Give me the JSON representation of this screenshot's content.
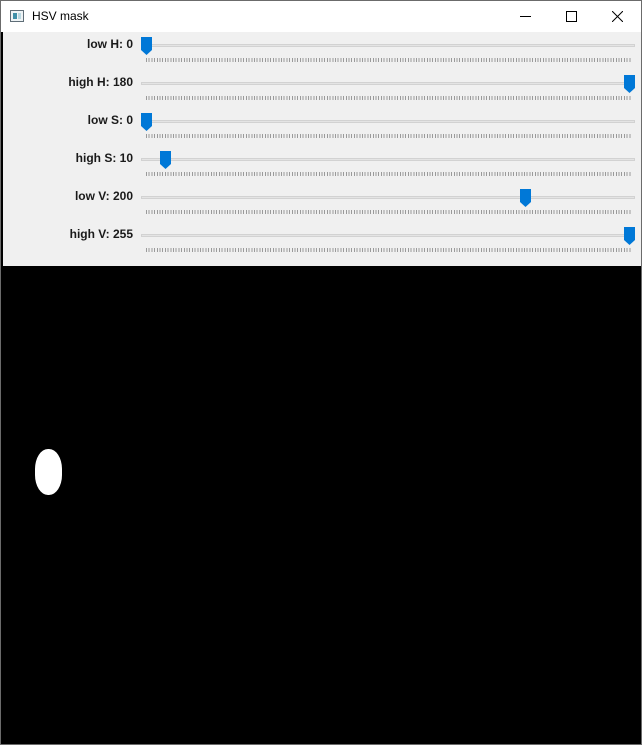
{
  "window": {
    "title": "HSV mask",
    "icon": "app-window-icon",
    "controls": [
      "minimize-icon",
      "maximize-icon",
      "close-icon"
    ]
  },
  "trackbars": [
    {
      "label": "low H: 0",
      "value": 0,
      "max": 180
    },
    {
      "label": "high H: 180",
      "value": 180,
      "max": 180
    },
    {
      "label": "low S: 0",
      "value": 0,
      "max": 255
    },
    {
      "label": "high S: 10",
      "value": 10,
      "max": 255
    },
    {
      "label": "low V: 200",
      "value": 200,
      "max": 255
    },
    {
      "label": "high V: 255",
      "value": 255,
      "max": 255
    }
  ],
  "colors": {
    "thumb": "#0078d7",
    "panel": "#f0f0f0",
    "mask_background": "#000000",
    "mask_foreground": "#ffffff"
  }
}
